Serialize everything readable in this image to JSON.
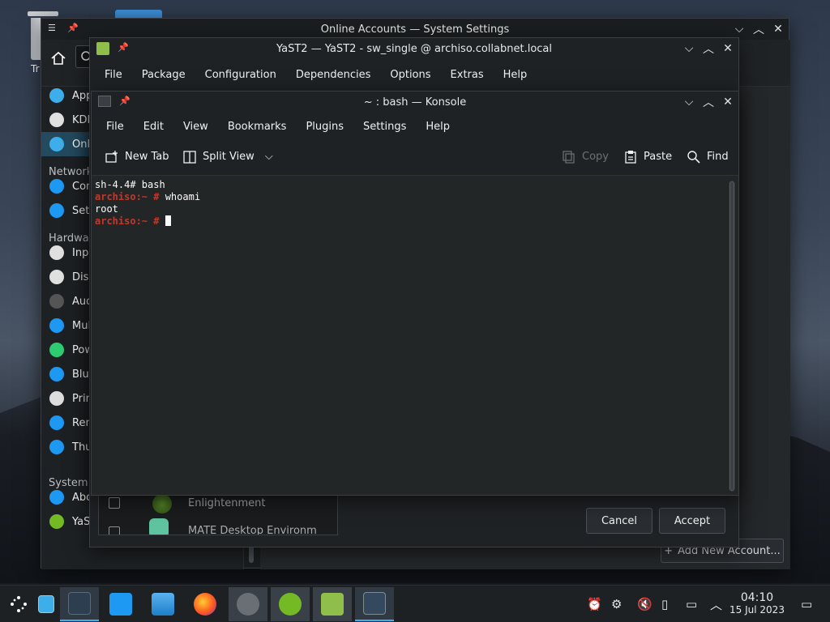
{
  "desktop": {
    "trash_label": "Tr"
  },
  "settings_window": {
    "title": "Online Accounts — System Settings",
    "sidebar": [
      {
        "label": "App",
        "icon": "apps-icon",
        "color": "#3daee9"
      },
      {
        "label": "KDE",
        "icon": "kde-connect-icon",
        "color": "#e0e0e0"
      },
      {
        "label": "Onl",
        "icon": "online-accounts-icon",
        "color": "#3daee9",
        "selected": true
      },
      {
        "label": "Con",
        "icon": "globe-icon",
        "color": "#1d99f3"
      },
      {
        "label": "Sett",
        "icon": "globe-icon",
        "color": "#1d99f3"
      },
      {
        "label": "Inpu",
        "icon": "mouse-icon",
        "color": "#e0e0e0"
      },
      {
        "label": "Disp",
        "icon": "monitor-icon",
        "color": "#e0e0e0"
      },
      {
        "label": "Aud",
        "icon": "speaker-icon",
        "color": "#555"
      },
      {
        "label": "Mul",
        "icon": "multimedia-icon",
        "color": "#1d99f3"
      },
      {
        "label": "Pow",
        "icon": "power-icon",
        "color": "#2ecc71"
      },
      {
        "label": "Blue",
        "icon": "bluetooth-icon",
        "color": "#1d99f3"
      },
      {
        "label": "Prin",
        "icon": "printer-icon",
        "color": "#ddd"
      },
      {
        "label": "Rem",
        "icon": "removable-icon",
        "color": "#1d99f3"
      },
      {
        "label": "Thu",
        "icon": "thunderbolt-icon",
        "color": "#1d99f3"
      },
      {
        "label": "Abo",
        "icon": "info-icon",
        "color": "#1d99f3"
      },
      {
        "label": "YaS",
        "icon": "yast-icon",
        "color": "#73ba25"
      }
    ],
    "headers": {
      "network": "Network",
      "hardware": "Hardwar",
      "system": "System A"
    },
    "add_account_label": "Add New Account..."
  },
  "yast_window": {
    "title": "YaST2 — YaST2 - sw_single @ archiso.collabnet.local",
    "menu": [
      "File",
      "Package",
      "Configuration",
      "Dependencies",
      "Options",
      "Extras",
      "Help"
    ],
    "list": [
      {
        "label": "Enlightenment",
        "icon": "enlightenment-icon"
      },
      {
        "label": "MATE Desktop Environm",
        "icon": "mate-icon"
      }
    ],
    "cancel_label": "Cancel",
    "accept_label": "Accept"
  },
  "konsole_window": {
    "title": "~ : bash — Konsole",
    "menu": [
      "File",
      "Edit",
      "View",
      "Bookmarks",
      "Plugins",
      "Settings",
      "Help"
    ],
    "toolbar": {
      "new_tab": "New Tab",
      "split_view": "Split View",
      "copy": "Copy",
      "paste": "Paste",
      "find": "Find"
    },
    "terminal": [
      {
        "prompt": "",
        "text": "sh-4.4# bash"
      },
      {
        "prompt": "archiso:~ #",
        "text": " whoami"
      },
      {
        "prompt": "",
        "text": "root"
      },
      {
        "prompt": "archiso:~ #",
        "text": " "
      }
    ]
  },
  "taskbar": {
    "clock_time": "04:10",
    "clock_date": "15 Jul 2023"
  }
}
